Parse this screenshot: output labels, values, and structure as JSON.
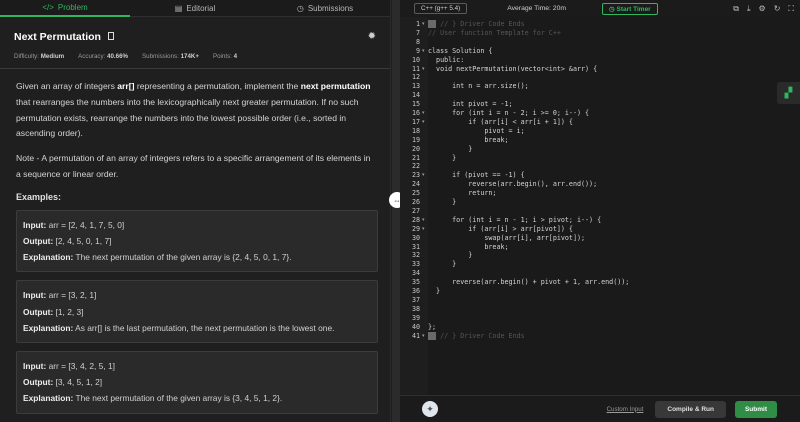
{
  "tabs": [
    {
      "icon": "</>",
      "label": "Problem"
    },
    {
      "icon": "▤",
      "label": "Editorial"
    },
    {
      "icon": "◷",
      "label": "Submissions"
    }
  ],
  "problem": {
    "title": "Next Permutation",
    "difficulty_label": "Difficulty:",
    "difficulty": "Medium",
    "accuracy_label": "Accuracy:",
    "accuracy": "40.66%",
    "submissions_label": "Submissions:",
    "submissions": "174K+",
    "points_label": "Points:",
    "points": "4",
    "desc_1": "Given an array of integers ",
    "desc_arr": "arr[]",
    "desc_2": " representing a permutation, implement the ",
    "desc_next": "next",
    "desc_perm": "permutation",
    "desc_3": " that rearranges the numbers into the lexicographically next greater permutation. If no such permutation exists, rearrange the numbers into the lowest possible order (i.e., sorted in ascending order).",
    "note": "Note - A permutation of an array of integers refers to a specific arrangement of its elements in a sequence or linear order.",
    "examples_label": "Examples:"
  },
  "examples": [
    {
      "input_label": "Input:",
      "input": "arr = [2, 4, 1, 7, 5, 0]",
      "output_label": "Output:",
      "output": "[2, 4, 5, 0, 1, 7]",
      "expl_label": "Explanation:",
      "explanation": "The next permutation of the given array is {2, 4, 5, 0, 1, 7}."
    },
    {
      "input_label": "Input:",
      "input": "arr = [3, 2, 1]",
      "output_label": "Output:",
      "output": "[1, 2, 3]",
      "expl_label": "Explanation:",
      "explanation": "As arr[] is the last permutation, the next permutation is the lowest one."
    },
    {
      "input_label": "Input:",
      "input": "arr = [3, 4, 2, 5, 1]",
      "output_label": "Output:",
      "output": "[3, 4, 5, 1, 2]",
      "expl_label": "Explanation:",
      "explanation": "The next permutation of the given array is {3, 4, 5, 1, 2}."
    }
  ],
  "editor": {
    "language": "C++ (g++ 5.4)",
    "avg_time": "Average Time: 20m",
    "timer": "Start Timer",
    "custom_input": "Custom Input",
    "compile_run": "Compile & Run",
    "submit": "Submit",
    "lines": [
      {
        "n": "1",
        "text": "// } Driver Code Ends",
        "fold": true,
        "kind": "guard"
      },
      {
        "n": "7",
        "text": "// User function Template for C++",
        "fold": false,
        "kind": "comment"
      },
      {
        "n": "8",
        "text": "",
        "fold": false,
        "kind": "code"
      },
      {
        "n": "9",
        "text": "class Solution {",
        "fold": true,
        "kind": "code"
      },
      {
        "n": "10",
        "text": "  public:",
        "fold": false,
        "kind": "code"
      },
      {
        "n": "11",
        "text": "  void nextPermutation(vector<int> &arr) {",
        "fold": true,
        "kind": "code"
      },
      {
        "n": "12",
        "text": "",
        "fold": false,
        "kind": "code"
      },
      {
        "n": "13",
        "text": "      int n = arr.size();",
        "fold": false,
        "kind": "code"
      },
      {
        "n": "14",
        "text": "",
        "fold": false,
        "kind": "code"
      },
      {
        "n": "15",
        "text": "      int pivot = -1;",
        "fold": false,
        "kind": "code"
      },
      {
        "n": "16",
        "text": "      for (int i = n - 2; i >= 0; i--) {",
        "fold": true,
        "kind": "code"
      },
      {
        "n": "17",
        "text": "          if (arr[i] < arr[i + 1]) {",
        "fold": true,
        "kind": "code"
      },
      {
        "n": "18",
        "text": "              pivot = i;",
        "fold": false,
        "kind": "code"
      },
      {
        "n": "19",
        "text": "              break;",
        "fold": false,
        "kind": "code"
      },
      {
        "n": "20",
        "text": "          }",
        "fold": false,
        "kind": "code"
      },
      {
        "n": "21",
        "text": "      }",
        "fold": false,
        "kind": "code"
      },
      {
        "n": "22",
        "text": "",
        "fold": false,
        "kind": "code"
      },
      {
        "n": "23",
        "text": "      if (pivot == -1) {",
        "fold": true,
        "kind": "code"
      },
      {
        "n": "24",
        "text": "          reverse(arr.begin(), arr.end());",
        "fold": false,
        "kind": "code"
      },
      {
        "n": "25",
        "text": "          return;",
        "fold": false,
        "kind": "code"
      },
      {
        "n": "26",
        "text": "      }",
        "fold": false,
        "kind": "code"
      },
      {
        "n": "27",
        "text": "",
        "fold": false,
        "kind": "code"
      },
      {
        "n": "28",
        "text": "      for (int i = n - 1; i > pivot; i--) {",
        "fold": true,
        "kind": "code"
      },
      {
        "n": "29",
        "text": "          if (arr[i] > arr[pivot]) {",
        "fold": true,
        "kind": "code"
      },
      {
        "n": "30",
        "text": "              swap(arr[i], arr[pivot]);",
        "fold": false,
        "kind": "code"
      },
      {
        "n": "31",
        "text": "              break;",
        "fold": false,
        "kind": "code"
      },
      {
        "n": "32",
        "text": "          }",
        "fold": false,
        "kind": "code"
      },
      {
        "n": "33",
        "text": "      }",
        "fold": false,
        "kind": "code"
      },
      {
        "n": "34",
        "text": "",
        "fold": false,
        "kind": "code"
      },
      {
        "n": "35",
        "text": "      reverse(arr.begin() + pivot + 1, arr.end());",
        "fold": false,
        "kind": "code"
      },
      {
        "n": "36",
        "text": "  }",
        "fold": false,
        "kind": "code"
      },
      {
        "n": "37",
        "text": "",
        "fold": false,
        "kind": "code"
      },
      {
        "n": "38",
        "text": "",
        "fold": false,
        "kind": "code"
      },
      {
        "n": "39",
        "text": "",
        "fold": false,
        "kind": "code"
      },
      {
        "n": "40",
        "text": "};",
        "fold": false,
        "kind": "code"
      },
      {
        "n": "41",
        "text": "// } Driver Code Ends",
        "fold": true,
        "kind": "guard"
      }
    ]
  },
  "colors": {
    "accent": "#2fb660",
    "submit_bg": "#2f8d46",
    "background": "#1e1e1e"
  }
}
